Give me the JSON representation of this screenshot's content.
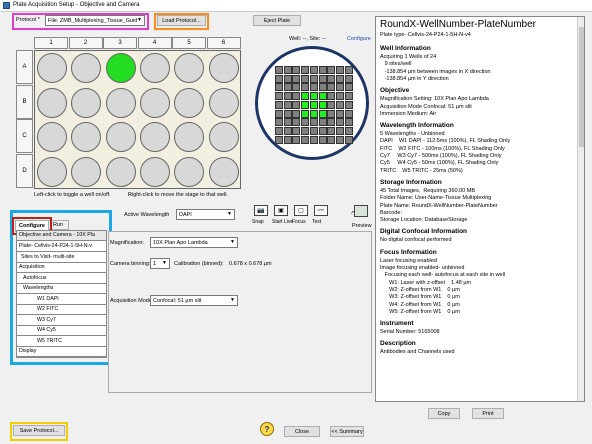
{
  "window": {
    "title": "Plate Acquisition Setup - Objective and Camera"
  },
  "toolbar": {
    "protocol_label": "Protocol *",
    "protocol_value": "File: ZMB_Multiplexing_Tissue_Guid",
    "load_protocol": "Load Protocol...",
    "eject_plate": "Eject Plate",
    "configure_link": "Configure",
    "well_site": "Well: --,  Site: --"
  },
  "plate": {
    "columns": [
      "1",
      "2",
      "3",
      "4",
      "5",
      "6"
    ],
    "rows": [
      "A",
      "B",
      "C",
      "D"
    ],
    "selected_well": "A3",
    "hint_left": "Left-click to toggle a well on/off.",
    "hint_right": "Right-click to move the stage to that well."
  },
  "sites": {
    "grid": 9,
    "selected": [
      [
        3,
        3
      ],
      [
        3,
        4
      ],
      [
        3,
        5
      ],
      [
        4,
        3
      ],
      [
        4,
        4
      ],
      [
        4,
        5
      ],
      [
        5,
        3
      ],
      [
        5,
        4
      ],
      [
        5,
        5
      ]
    ]
  },
  "tabs": {
    "configure": "Configure",
    "run": "Run"
  },
  "tree": {
    "header": "Objective and Camera - 10X Pla",
    "items": [
      "Plate- Cellvis-24-P24-1-5H-N-v",
      "Sites to Visit- multi-site",
      "Acquisition",
      "Autofocus",
      "Wavelengths",
      "W1 DAPI",
      "W2 FITC",
      "W3 Cy7",
      "W4 Cy5",
      "W5 TRITC",
      "Display"
    ]
  },
  "wavelength": {
    "label": "Active Wavelength",
    "value": "DAPI",
    "buttons": [
      "Snap",
      "Start Live",
      "Focus",
      "Test"
    ],
    "preview": "Preview"
  },
  "settings": {
    "magnification_label": "Magnification:",
    "magnification_value": "10X Plan Apo Lambda",
    "binning_label": "Camera binning:",
    "binning_value": "1",
    "calibration_label": "Calibration (binned):",
    "calibration_value": "0.678 x 0.678 µm",
    "mode_label": "Acquisition Mode:",
    "mode_value": "Confocal: 51 µm slit"
  },
  "bottom": {
    "save_protocol": "Save Protocol...",
    "close": "Close",
    "summary": "<< Summary",
    "copy": "Copy",
    "print": "Print"
  },
  "info": {
    "title": "RoundX-WellNumber-PlateNumber",
    "plate_type": "Plate type- Cellvis-24-P24-1-5H-N-v4",
    "well_h": "Well Information",
    "well_lines": [
      "Acquiring 1 Wells of 24",
      "   9 sites/well",
      "   -138.854 µm between images in X direction",
      "   -138.854 µm in Y direction"
    ],
    "obj_h": "Objective",
    "obj_lines": [
      "Magnification Setting: 10X Plan Apo Lambda",
      "Acquisition Mode Confocal: 51 µm slit",
      "Immersion Medium: Air"
    ],
    "wl_h": "Wavelength Information",
    "wl_lines": [
      "5 Wavelengths - Unbinned",
      "DAPI    W1 DAPI - 112.5ms (100%), FL Shading Only",
      "FITC    W2 FITC - 100ms (100%), FL Shading Only",
      "Cy7     W3 Cy7 - 500ms (100%), FL Shading Only",
      "Cy5     W4 Cy5 - 50ms (100%), FL Shading Only",
      "TRITC    W5 TRITC - 25ms (50%)"
    ],
    "st_h": "Storage Information",
    "st_lines": [
      "45 Total Images,  Requiring 360.00 MB",
      "Folder Name: User-Name-Tissue Multiplexing",
      "Plate Name: RoundX-WellNumber-PlateNumber",
      "Barcode:",
      "Storage Location: DatabaseStorage"
    ],
    "dc_h": "Digital Confocal Information",
    "dc_lines": [
      "No digital confocal performed"
    ],
    "fo_h": "Focus Information",
    "fo_lines": [
      "Laser focusing enabled",
      "Image focusing enabled- unbinned",
      "   Focusing each well- autofocus at each site in well",
      "      W1: Laser with z-offset    1.48 µm",
      "      W2: Z-offset from W1    0 µm",
      "      W3: Z-offset from W1    0 µm",
      "      W4: Z-offset from W1    0 µm",
      "      W5: Z-offset from W1    0 µm"
    ],
    "in_h": "Instrument",
    "in_lines": [
      "Serial Number: 5165008"
    ],
    "de_h": "Description",
    "de_lines": [
      "Antibodies and Channels used"
    ]
  },
  "colors": {
    "highlight_pink": "#e040c8",
    "highlight_orange": "#ff8c1a",
    "highlight_blue": "#1aa7e6",
    "highlight_yellow": "#f0d000",
    "highlight_red": "#c0201a",
    "site_on": "#22ee22",
    "well_on": "#22dd22"
  }
}
